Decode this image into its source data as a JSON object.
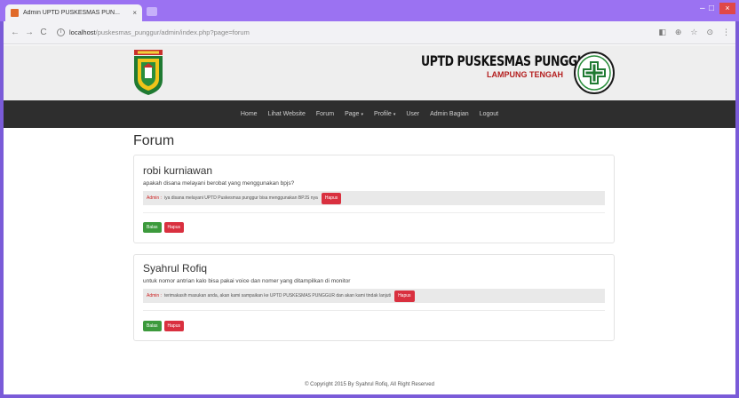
{
  "browser": {
    "tab_title": "Admin UPTD PUSKESMAS PUN...",
    "tab_close": "×",
    "url_host": "localhost",
    "url_path": "/puskesmas_punggur/admin/index.php?page=forum",
    "win_min": "–",
    "win_max": "□",
    "win_close": "×",
    "nav_back": "←",
    "nav_forward": "→",
    "nav_reload": "C",
    "info_icon": "i",
    "ext1": "◧",
    "ext2": "⊕",
    "star": "☆",
    "profile": "⊙",
    "menu": "⋮"
  },
  "header": {
    "banner_title": "UPTD PUSKESMAS PUNGGUR",
    "banner_sub": "LAMPUNG TENGAH"
  },
  "nav": [
    {
      "label": "Home"
    },
    {
      "label": "Lihat Website"
    },
    {
      "label": "Forum"
    },
    {
      "label": "Page",
      "caret": "▾"
    },
    {
      "label": "Profile",
      "caret": "▾"
    },
    {
      "label": "User"
    },
    {
      "label": "Admin Bagian"
    },
    {
      "label": "Logout"
    }
  ],
  "page": {
    "title": "Forum"
  },
  "posts": [
    {
      "author": "robi kurniawan",
      "question": "apakah disana melayani berobat yang menggunakan bpjs?",
      "reply_label": "Admin :",
      "reply_text": "iya disana melayani UPTD Puskesmas punggur bisa menggunakan BPJS nya",
      "reply_delete": "Hapus",
      "balas": "Balas",
      "hapus": "Hapus"
    },
    {
      "author": "Syahrul Rofiq",
      "question": "untuk nomor antrian kalo bisa pakai voice dan nomer yang ditampilkan di monitor",
      "reply_label": "Admin :",
      "reply_text": "terimakasih masukan anda, akan kami sampaikan ke UPTD PUSKESMAS PUNGGUR dan akan kami tindak lanjuti",
      "reply_delete": "Hapus",
      "balas": "Balas",
      "hapus": "Hapus"
    }
  ],
  "footer": {
    "text": "© Copyright 2015 By Syahrul Rofiq, All Right Reserved"
  },
  "colors": {
    "titlebar": "#9b72f2",
    "navbar": "#2e2e2e",
    "danger": "#d9303f",
    "success": "#3c9a3c"
  }
}
